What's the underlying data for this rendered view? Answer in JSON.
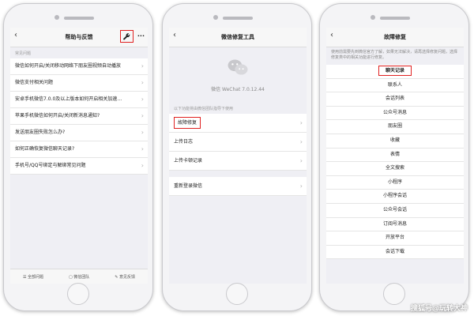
{
  "screen1": {
    "title": "帮助与反馈",
    "more": "···",
    "section": "常见问题",
    "items": [
      "微信如何开启/关闭移动网络下朋友圈视频自动播放",
      "微信支付相关问题",
      "安卓手机微信7.0.0及以上版本如何开启相关加速…",
      "苹果手机微信如何开启/关闭新消息通知?",
      "发送朋友圈失败怎么办?",
      "如何正确恢复微信聊天记录?",
      "手机号/QQ号绑定与解绑常见问题"
    ],
    "tabs": [
      "全部问题",
      "微信团队",
      "意见反馈"
    ]
  },
  "screen2": {
    "title": "微信修复工具",
    "version": "微信 WeChat 7.0.12.44",
    "section": "以下功能将由微信团队指导下使用",
    "items": [
      "故障修复",
      "上传日志",
      "上传卡顿记录"
    ],
    "single_item": "重新登录微信"
  },
  "screen3": {
    "title": "故障修复",
    "description": "使用前需要先到微信官方了解，如果无法解决，请再选择修复问题，选择修复类中的相关功能进行修复。",
    "items": [
      "聊天记录",
      "联系人",
      "会话列表",
      "公众号消息",
      "朋友圈",
      "收藏",
      "表情",
      "全文搜索",
      "小程序",
      "小程序会话",
      "公众号会话",
      "订阅号消息",
      "开放平台",
      "会话下载"
    ]
  },
  "colors": {
    "highlight": "#e02020",
    "watermark": "#ffffff"
  },
  "watermark": "搜狐号@玩转大神"
}
